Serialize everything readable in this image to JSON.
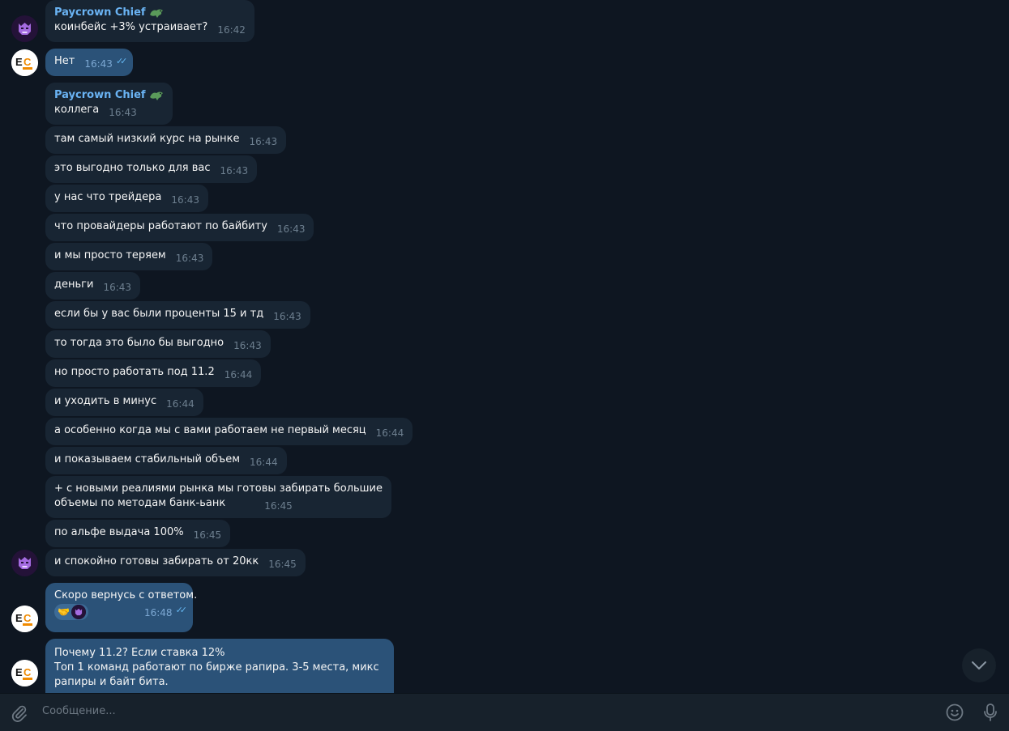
{
  "peer_name": "Paycrown Chief",
  "self_avatar_text": "EC",
  "messages": [
    {
      "text": "коинбейс +3% устраивает?",
      "time": "16:42"
    },
    {
      "text": "Нет",
      "time": "16:43"
    },
    {
      "text": "коллега",
      "time": "16:43"
    },
    {
      "text": "там самый низкий курс на рынке",
      "time": "16:43"
    },
    {
      "text": "это выгодно только для вас",
      "time": "16:43"
    },
    {
      "text": "у нас что трейдера",
      "time": "16:43"
    },
    {
      "text": "что провайдеры работают по байбиту",
      "time": "16:43"
    },
    {
      "text": "и мы просто теряем",
      "time": "16:43"
    },
    {
      "text": "деньги",
      "time": "16:43"
    },
    {
      "text": "если бы у вас были проценты 15 и тд",
      "time": "16:43"
    },
    {
      "text": "то тогда это было бы выгодно",
      "time": "16:43"
    },
    {
      "text": "но просто работать под 11.2",
      "time": "16:44"
    },
    {
      "text": "и уходить в минус",
      "time": "16:44"
    },
    {
      "text": "а особенно когда мы с вами работаем не первый месяц",
      "time": "16:44"
    },
    {
      "text": "и показываем стабильный объем",
      "time": "16:44"
    },
    {
      "line1": "+ с новыми реалиями рынка мы готовы забирать большие",
      "line2": "объемы по методам банк-ьанк",
      "time": "16:45"
    },
    {
      "text": "по альфе выдача 100%",
      "time": "16:45"
    },
    {
      "text": "и спокойно готовы забирать от 20кк",
      "time": "16:45"
    },
    {
      "text": "Скоро вернусь с ответом.",
      "time": "16:48",
      "reaction": "handshake-emoji"
    },
    {
      "line1": "Почему 11.2? Если ставка 12%",
      "line2": "Топ 1 команд работают по бирже рапира. 3-5 места, микс",
      "line3": "рапиры и байт бита."
    }
  ],
  "composer": {
    "placeholder": "Сообщение...",
    "icons": [
      "paperclip-icon",
      "emoji-icon",
      "microphone-icon"
    ]
  },
  "colors": {
    "background": "#0e1621",
    "incoming_bubble": "#182533",
    "outgoing_bubble": "#2b5278",
    "sender_name": "#6ab3f3",
    "composer": "#17212b"
  }
}
